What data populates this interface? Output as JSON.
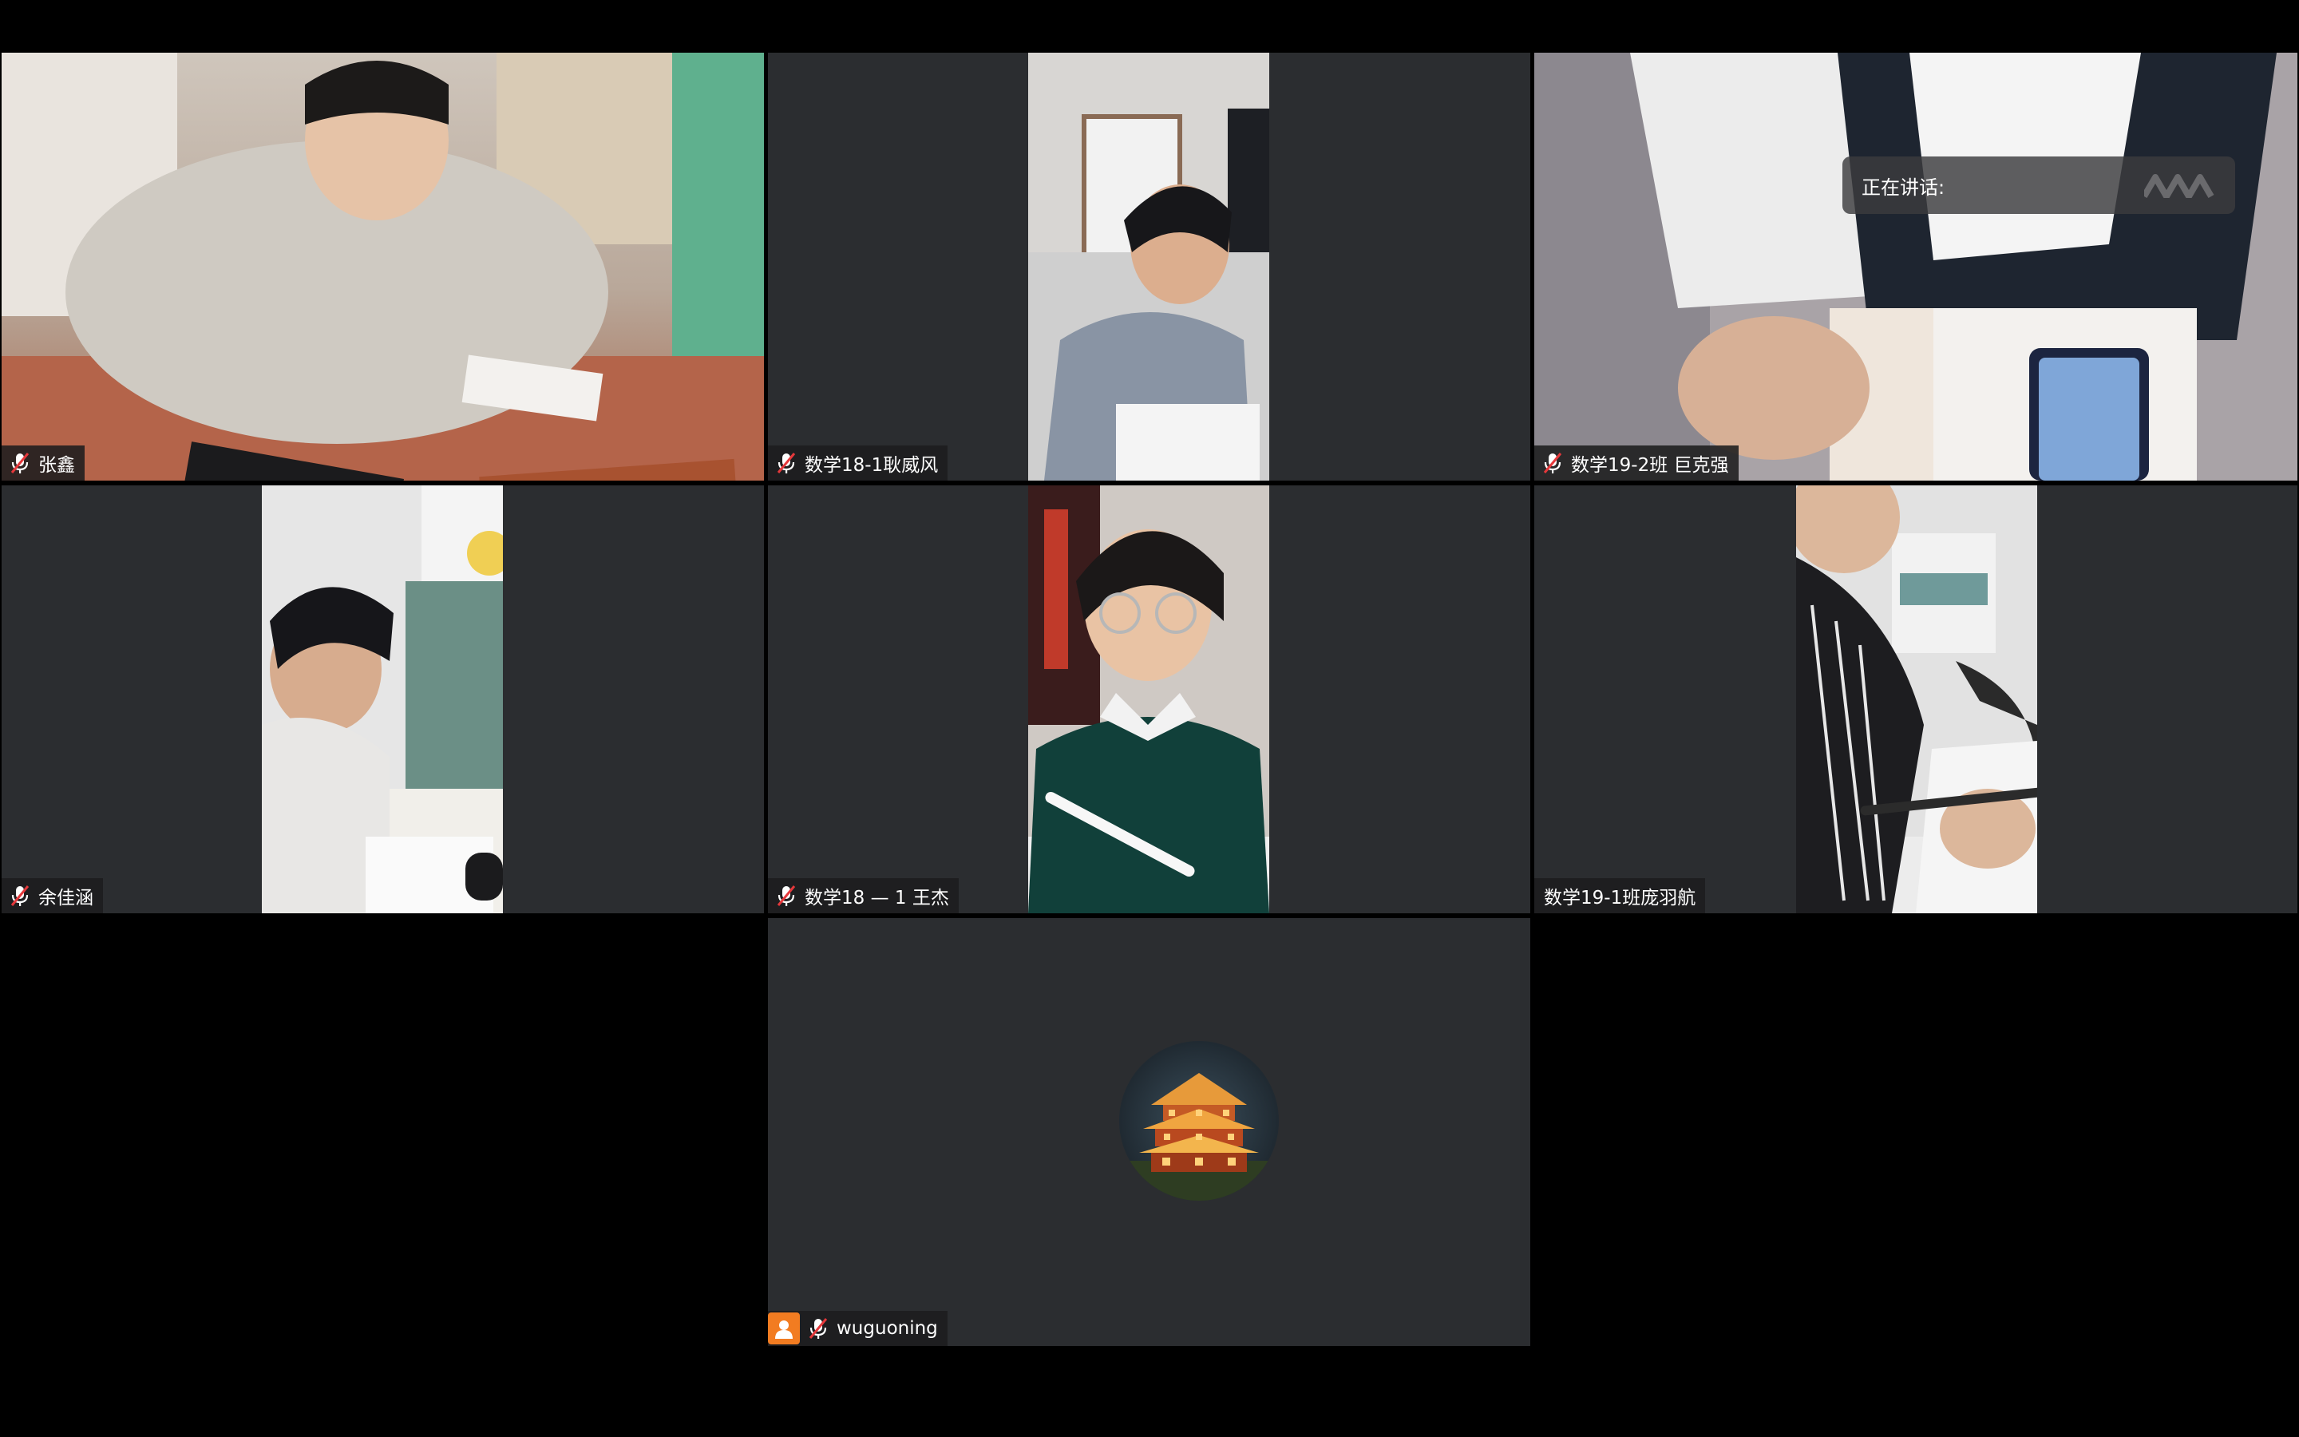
{
  "app": {
    "view": "gallery"
  },
  "speaking_indicator": {
    "label": "正在讲话:",
    "speaker": ""
  },
  "participants": [
    {
      "name": "张鑫",
      "muted": true,
      "video": "on"
    },
    {
      "name": "数学18-1耿威风",
      "muted": true,
      "video": "on"
    },
    {
      "name": "数学19-2班  巨克强",
      "muted": true,
      "video": "on"
    },
    {
      "name": "余佳涵",
      "muted": true,
      "video": "on"
    },
    {
      "name": "数学18 — 1 王杰",
      "muted": true,
      "video": "on"
    },
    {
      "name": "数学19-1班庞羽航",
      "muted": false,
      "video": "on"
    },
    {
      "name": "wuguoning",
      "muted": true,
      "video": "off",
      "host": true
    }
  ],
  "colors": {
    "background": "#000000",
    "tile": "#2b2d30",
    "mute_red": "#e5383b",
    "host_badge": "#f27c21"
  }
}
